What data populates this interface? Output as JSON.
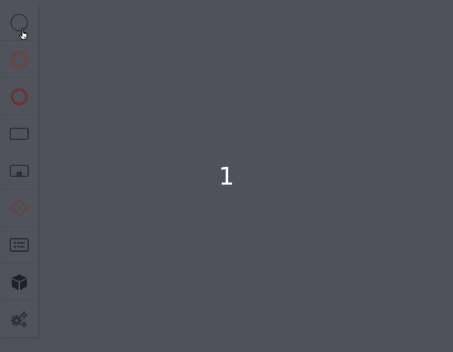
{
  "palette": {
    "tools": [
      {
        "id": "start-event",
        "icon": "circle-thin-icon"
      },
      {
        "id": "intermediate-event",
        "icon": "double-circle-icon"
      },
      {
        "id": "end-event",
        "icon": "thick-circle-icon"
      },
      {
        "id": "task",
        "icon": "rounded-rectangle-icon"
      },
      {
        "id": "subprocess",
        "icon": "collapsed-subprocess-icon"
      },
      {
        "id": "gateway",
        "icon": "diamond-icon"
      },
      {
        "id": "data-object",
        "icon": "list-card-icon"
      },
      {
        "id": "participant",
        "icon": "cube-icon"
      },
      {
        "id": "settings",
        "icon": "gears-icon"
      }
    ]
  },
  "overlay": {
    "step_number": "1"
  },
  "colors": {
    "background": "#4f525b",
    "icon_dark": "#2c2f36",
    "icon_red": "#7a3a3a"
  }
}
